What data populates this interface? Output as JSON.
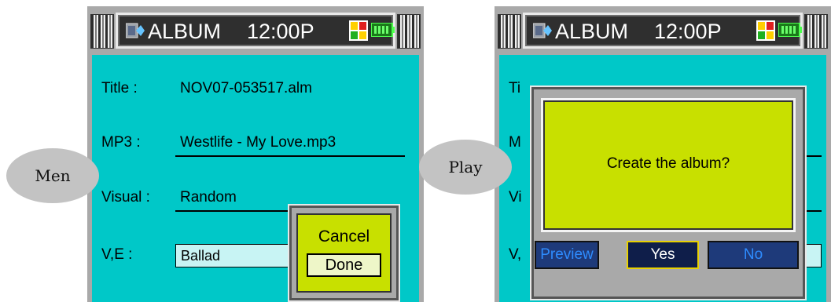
{
  "left_screen": {
    "statusbar": {
      "title": "ALBUM",
      "time": "12:00P",
      "album_icon": "album-icon",
      "status_icon": "squares-icon",
      "battery_icon": "battery-icon"
    },
    "fields": {
      "title_label": "Title :",
      "title_value": "NOV07-053517.alm",
      "mp3_label": "MP3 :",
      "mp3_value": "Westlife - My Love.mp3",
      "visual_label": "Visual :",
      "visual_value": "Random",
      "ve_label": "V,E :",
      "ve_value": "Ballad"
    },
    "menu": {
      "items": [
        "Cancel",
        "Done"
      ],
      "selected": "Done"
    },
    "bubble_label": "Men"
  },
  "right_screen": {
    "statusbar": {
      "title": "ALBUM",
      "time": "12:00P"
    },
    "visible_labels": {
      "title": "Ti",
      "mp3": "M",
      "visual": "Vi",
      "ve": "V,"
    },
    "dialog": {
      "message": "Create the album?",
      "buttons": [
        "Preview",
        "Yes",
        "No"
      ],
      "selected": "Yes"
    },
    "bubble_label": "Play"
  },
  "colors": {
    "content_bg": "#00c8c8",
    "popup_bg": "#c8e000",
    "button_bg": "#1e3a7a",
    "button_text": "#2e8cff"
  }
}
